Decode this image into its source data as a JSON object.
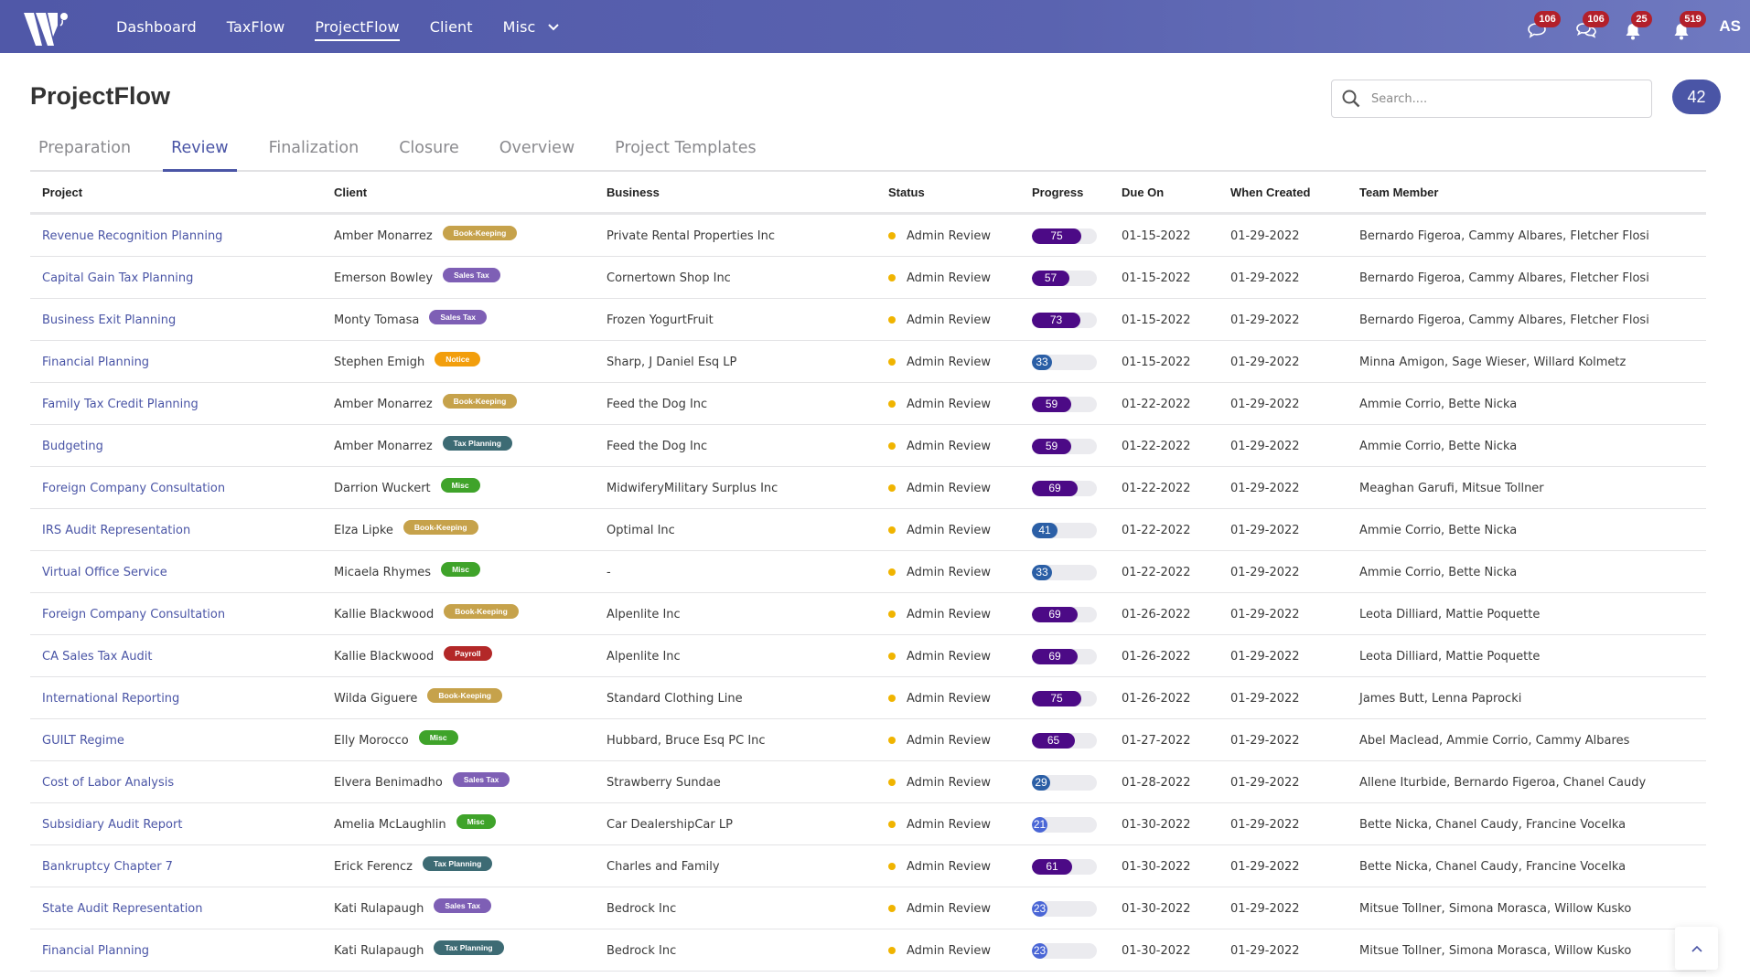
{
  "nav": {
    "logo": "W-logo",
    "items": [
      {
        "label": "Dashboard",
        "active": false
      },
      {
        "label": "TaxFlow",
        "active": false
      },
      {
        "label": "ProjectFlow",
        "active": true
      },
      {
        "label": "Client",
        "active": false
      },
      {
        "label": "Misc",
        "active": false,
        "dropdown": true
      }
    ],
    "notifications": [
      {
        "icon": "chat-icon",
        "count": "106"
      },
      {
        "icon": "chats-icon",
        "count": "106"
      },
      {
        "icon": "bell-icon",
        "count": "25"
      },
      {
        "icon": "bell-icon",
        "count": "519"
      }
    ],
    "user_initials": "AS"
  },
  "page": {
    "title": "ProjectFlow",
    "search_placeholder": "Search....",
    "search_value": "",
    "count": "42"
  },
  "tabs": [
    {
      "label": "Preparation",
      "active": false
    },
    {
      "label": "Review",
      "active": true
    },
    {
      "label": "Finalization",
      "active": false
    },
    {
      "label": "Closure",
      "active": false
    },
    {
      "label": "Overview",
      "active": false
    },
    {
      "label": "Project Templates",
      "active": false
    }
  ],
  "tag_colors": {
    "Book-Keeping": "#c6a24b",
    "Sales Tax": "#7e5fb5",
    "Notice": "#f29e0c",
    "Tax Planning": "#3d6b74",
    "Misc": "#3fa32a",
    "Payroll": "#b32828"
  },
  "progress_colors": {
    "high": "#4c0a86",
    "mid": "#2b5fa6",
    "low": "#4a66d6"
  },
  "status_color": "#f0b400",
  "table": {
    "columns": [
      "Project",
      "Client",
      "Business",
      "Status",
      "Progress",
      "Due On",
      "When Created",
      "Team Member"
    ],
    "rows": [
      {
        "project": "Revenue Recognition Planning",
        "client": "Amber Monarrez",
        "tag": "Book-Keeping",
        "business": "Private Rental Properties Inc",
        "status": "Admin Review",
        "progress": 75,
        "due": "01-15-2022",
        "created": "01-29-2022",
        "team": "Bernardo Figeroa, Cammy Albares, Fletcher Flosi"
      },
      {
        "project": "Capital Gain Tax Planning",
        "client": "Emerson Bowley",
        "tag": "Sales Tax",
        "business": "Cornertown Shop Inc",
        "status": "Admin Review",
        "progress": 57,
        "due": "01-15-2022",
        "created": "01-29-2022",
        "team": "Bernardo Figeroa, Cammy Albares, Fletcher Flosi"
      },
      {
        "project": "Business Exit Planning",
        "client": "Monty Tomasa",
        "tag": "Sales Tax",
        "business": "Frozen YogurtFruit",
        "status": "Admin Review",
        "progress": 73,
        "due": "01-15-2022",
        "created": "01-29-2022",
        "team": "Bernardo Figeroa, Cammy Albares, Fletcher Flosi"
      },
      {
        "project": "Financial Planning",
        "client": "Stephen Emigh",
        "tag": "Notice",
        "business": "Sharp, J Daniel Esq LP",
        "status": "Admin Review",
        "progress": 33,
        "due": "01-15-2022",
        "created": "01-29-2022",
        "team": "Minna Amigon, Sage Wieser, Willard Kolmetz"
      },
      {
        "project": "Family Tax Credit Planning",
        "client": "Amber Monarrez",
        "tag": "Book-Keeping",
        "business": "Feed the Dog Inc",
        "status": "Admin Review",
        "progress": 59,
        "due": "01-22-2022",
        "created": "01-29-2022",
        "team": "Ammie Corrio, Bette Nicka"
      },
      {
        "project": "Budgeting",
        "client": "Amber Monarrez",
        "tag": "Tax Planning",
        "business": "Feed the Dog Inc",
        "status": "Admin Review",
        "progress": 59,
        "due": "01-22-2022",
        "created": "01-29-2022",
        "team": "Ammie Corrio, Bette Nicka"
      },
      {
        "project": "Foreign Company Consultation",
        "client": "Darrion Wuckert",
        "tag": "Misc",
        "business": "MidwiferyMilitary Surplus Inc",
        "status": "Admin Review",
        "progress": 69,
        "due": "01-22-2022",
        "created": "01-29-2022",
        "team": "Meaghan Garufi, Mitsue Tollner"
      },
      {
        "project": "IRS Audit Representation",
        "client": "Elza Lipke",
        "tag": "Book-Keeping",
        "business": "Optimal Inc",
        "status": "Admin Review",
        "progress": 41,
        "due": "01-22-2022",
        "created": "01-29-2022",
        "team": "Ammie Corrio, Bette Nicka"
      },
      {
        "project": "Virtual Office Service",
        "client": "Micaela Rhymes",
        "tag": "Misc",
        "business": "-",
        "status": "Admin Review",
        "progress": 33,
        "due": "01-22-2022",
        "created": "01-29-2022",
        "team": "Ammie Corrio, Bette Nicka"
      },
      {
        "project": "Foreign Company Consultation",
        "client": "Kallie Blackwood",
        "tag": "Book-Keeping",
        "business": "Alpenlite Inc",
        "status": "Admin Review",
        "progress": 69,
        "due": "01-26-2022",
        "created": "01-29-2022",
        "team": "Leota Dilliard, Mattie Poquette"
      },
      {
        "project": "CA Sales Tax Audit",
        "client": "Kallie Blackwood",
        "tag": "Payroll",
        "business": "Alpenlite Inc",
        "status": "Admin Review",
        "progress": 69,
        "due": "01-26-2022",
        "created": "01-29-2022",
        "team": "Leota Dilliard, Mattie Poquette"
      },
      {
        "project": "International Reporting",
        "client": "Wilda Giguere",
        "tag": "Book-Keeping",
        "business": "Standard Clothing Line",
        "status": "Admin Review",
        "progress": 75,
        "due": "01-26-2022",
        "created": "01-29-2022",
        "team": "James Butt, Lenna Paprocki"
      },
      {
        "project": "GUILT Regime",
        "client": "Elly Morocco",
        "tag": "Misc",
        "business": "Hubbard, Bruce Esq PC Inc",
        "status": "Admin Review",
        "progress": 65,
        "due": "01-27-2022",
        "created": "01-29-2022",
        "team": "Abel Maclead, Ammie Corrio, Cammy Albares"
      },
      {
        "project": "Cost of Labor Analysis",
        "client": "Elvera Benimadho",
        "tag": "Sales Tax",
        "business": "Strawberry Sundae",
        "status": "Admin Review",
        "progress": 29,
        "due": "01-28-2022",
        "created": "01-29-2022",
        "team": "Allene Iturbide, Bernardo Figeroa, Chanel Caudy"
      },
      {
        "project": "Subsidiary Audit Report",
        "client": "Amelia McLaughlin",
        "tag": "Misc",
        "business": "Car DealershipCar LP",
        "status": "Admin Review",
        "progress": 21,
        "due": "01-30-2022",
        "created": "01-29-2022",
        "team": "Bette Nicka, Chanel Caudy, Francine Vocelka"
      },
      {
        "project": "Bankruptcy Chapter 7",
        "client": "Erick Ferencz",
        "tag": "Tax Planning",
        "business": "Charles and Family",
        "status": "Admin Review",
        "progress": 61,
        "due": "01-30-2022",
        "created": "01-29-2022",
        "team": "Bette Nicka, Chanel Caudy, Francine Vocelka"
      },
      {
        "project": "State Audit Representation",
        "client": "Kati Rulapaugh",
        "tag": "Sales Tax",
        "business": "Bedrock Inc",
        "status": "Admin Review",
        "progress": 23,
        "due": "01-30-2022",
        "created": "01-29-2022",
        "team": "Mitsue Tollner, Simona Morasca, Willow Kusko"
      },
      {
        "project": "Financial Planning",
        "client": "Kati Rulapaugh",
        "tag": "Tax Planning",
        "business": "Bedrock Inc",
        "status": "Admin Review",
        "progress": 23,
        "due": "01-30-2022",
        "created": "01-29-2022",
        "team": "Mitsue Tollner, Simona Morasca, Willow Kusko"
      }
    ]
  }
}
